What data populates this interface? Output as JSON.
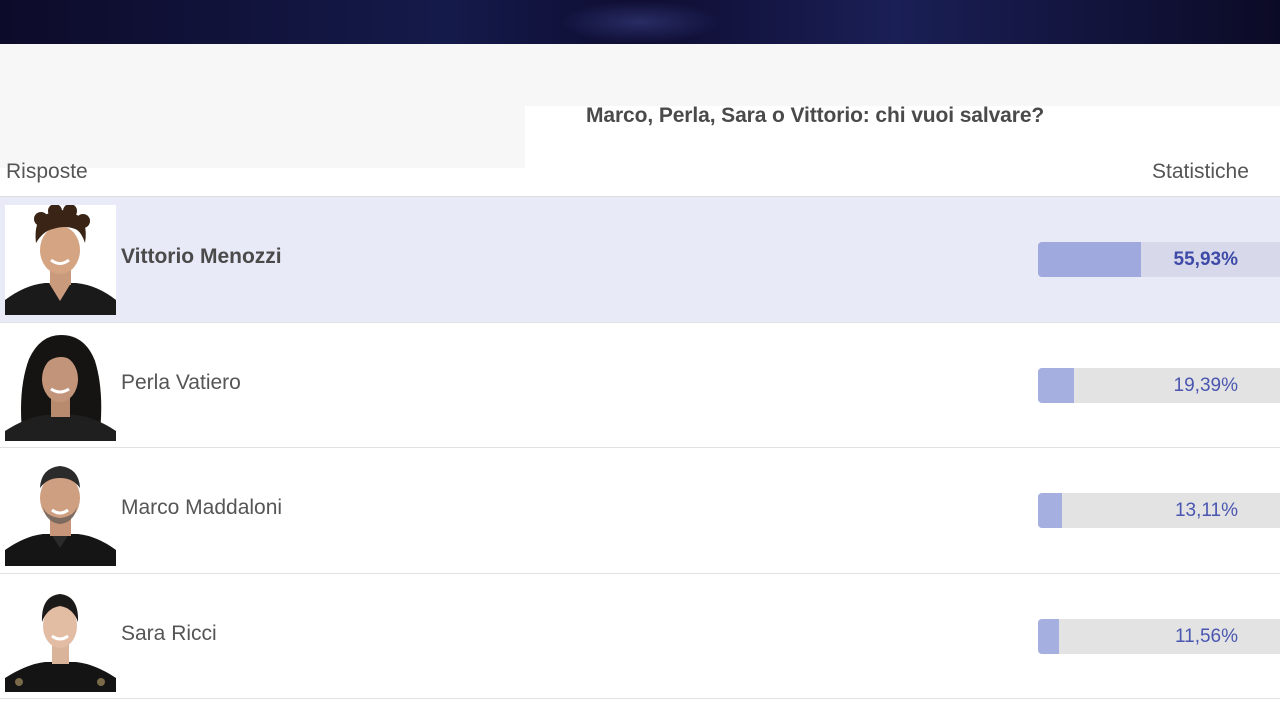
{
  "poll": {
    "question": "Marco, Perla, Sara o Vittorio: chi vuoi salvare?",
    "answers_header": "Risposte",
    "stats_header": "Statistiche"
  },
  "options": [
    {
      "name": "Vittorio Menozzi",
      "percent_label": "55,93%",
      "percent": 55.93,
      "selected": true
    },
    {
      "name": "Perla Vatiero",
      "percent_label": "19,39%",
      "percent": 19.39,
      "selected": false
    },
    {
      "name": "Marco Maddaloni",
      "percent_label": "13,11%",
      "percent": 13.11,
      "selected": false
    },
    {
      "name": "Sara Ricci",
      "percent_label": "11,56%",
      "percent": 11.56,
      "selected": false
    }
  ],
  "colors": {
    "bar_fill": "#a6b0e0",
    "bar_track": "#e3e3e3",
    "percent_text": "#4a56b0",
    "highlight_row": "#e9eaf7",
    "banner": "#0f0d33"
  }
}
